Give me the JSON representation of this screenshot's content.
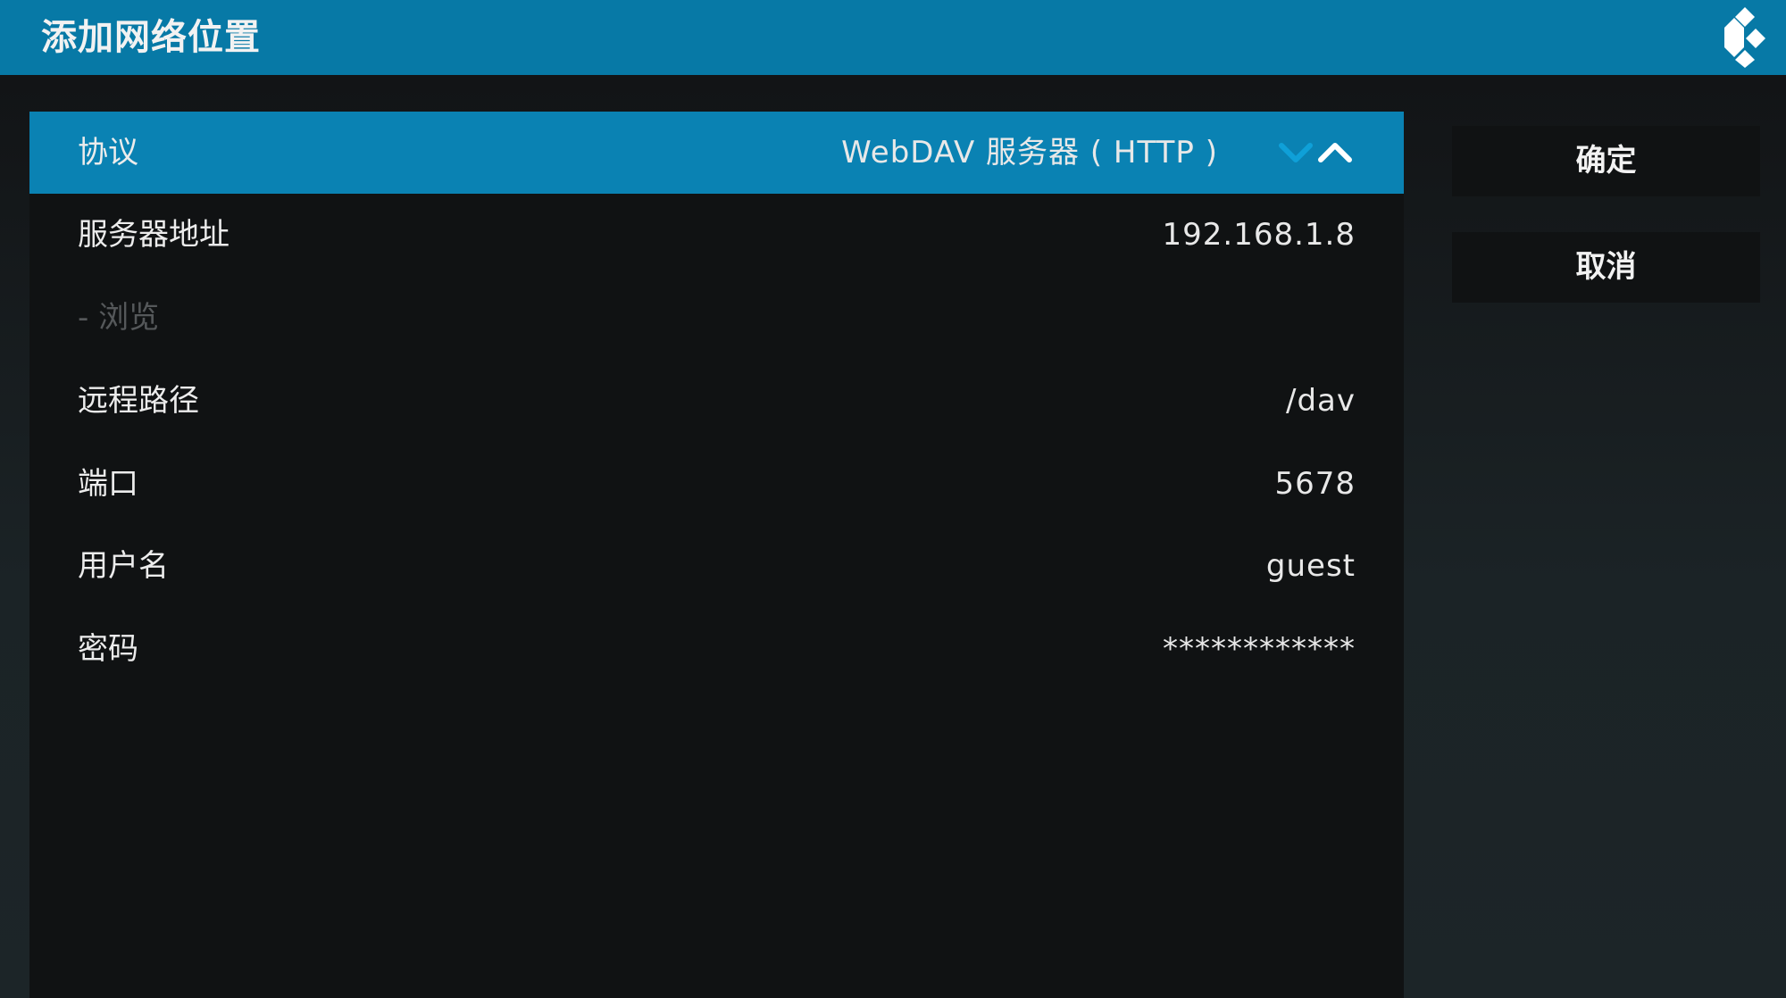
{
  "header": {
    "title": "添加网络位置",
    "logo_icon": "kodi-logo-icon"
  },
  "settings": [
    {
      "label": "协议",
      "value": "WebDAV 服务器 ( HTTP )",
      "focused": true,
      "disabled": false
    },
    {
      "label": "服务器地址",
      "value": "192.168.1.8",
      "focused": false,
      "disabled": false
    },
    {
      "label": "- 浏览",
      "value": "",
      "focused": false,
      "disabled": true
    },
    {
      "label": "远程路径",
      "value": "/dav",
      "focused": false,
      "disabled": false
    },
    {
      "label": "端口",
      "value": "5678",
      "focused": false,
      "disabled": false
    },
    {
      "label": "用户名",
      "value": "guest",
      "focused": false,
      "disabled": false
    },
    {
      "label": "密码",
      "value": "************",
      "focused": false,
      "disabled": false
    }
  ],
  "spin_controls": {
    "down_icon": "chevron-down-icon",
    "up_icon": "chevron-up-icon"
  },
  "buttons": {
    "ok_label": "确定",
    "cancel_label": "取消"
  },
  "colors": {
    "header_bg": "#0779a6",
    "focus_bg": "#0a82b3",
    "panel_bg": "#101213",
    "spin_down": "#0fa0d8",
    "text": "#ececec",
    "disabled_text": "#55585a"
  }
}
